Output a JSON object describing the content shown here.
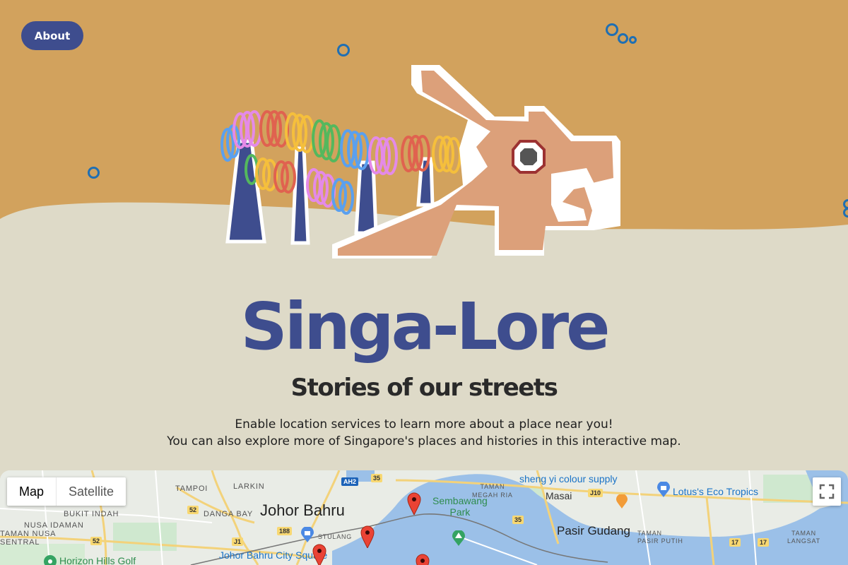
{
  "nav": {
    "about_label": "About"
  },
  "hero": {
    "title": "Singa-Lore",
    "subtitle": "Stories of our streets",
    "description": [
      "Enable location services to learn more about a place near you!",
      "You can also explore more of Singapore's places and histories in this interactive map."
    ]
  },
  "map": {
    "type_options": [
      "Map",
      "Satellite"
    ],
    "selected_type": "Map",
    "labels": {
      "tampoi": "TAMPOI",
      "larkin": "LARKIN",
      "bukit_indah": "BUKIT INDAH",
      "danga_bay": "DANGA BAY",
      "johor_bahru": "Johor Bahru",
      "nusa_idaman": "NUSA IDAMAN",
      "taman_nusa_sentral": "TAMAN NUSA\nSENTRAL",
      "horizon_hills": "Horizon Hills Golf",
      "jb_city_square": "Johor Bahru City Square",
      "stulang": "STULANG",
      "taman_megah_ria": "TAMAN\nMEGAH RIA",
      "sembawang_park": "Sembawang\nPark",
      "sheng_yi": "sheng yi colour supply",
      "masai": "Masai",
      "lotus": "Lotus's Eco Tropics",
      "pasir_gudang": "Pasir Gudang",
      "taman_pasir_putih": "TAMAN\nPASIR PUTIH",
      "taman_langsat": "TAMAN\nLANGSAT"
    },
    "road_shields": [
      "AH2",
      "35",
      "J10",
      "52",
      "188",
      "J1",
      "52",
      "35",
      "17",
      "17"
    ]
  },
  "colors": {
    "sand": "#d2a25d",
    "beige": "#dedac8",
    "navy": "#3e4d8e",
    "bubble": "#1f6fb3",
    "dragon_head": "#dca07a",
    "map_water": "#9bc0e8",
    "map_land": "#e9ece6"
  }
}
